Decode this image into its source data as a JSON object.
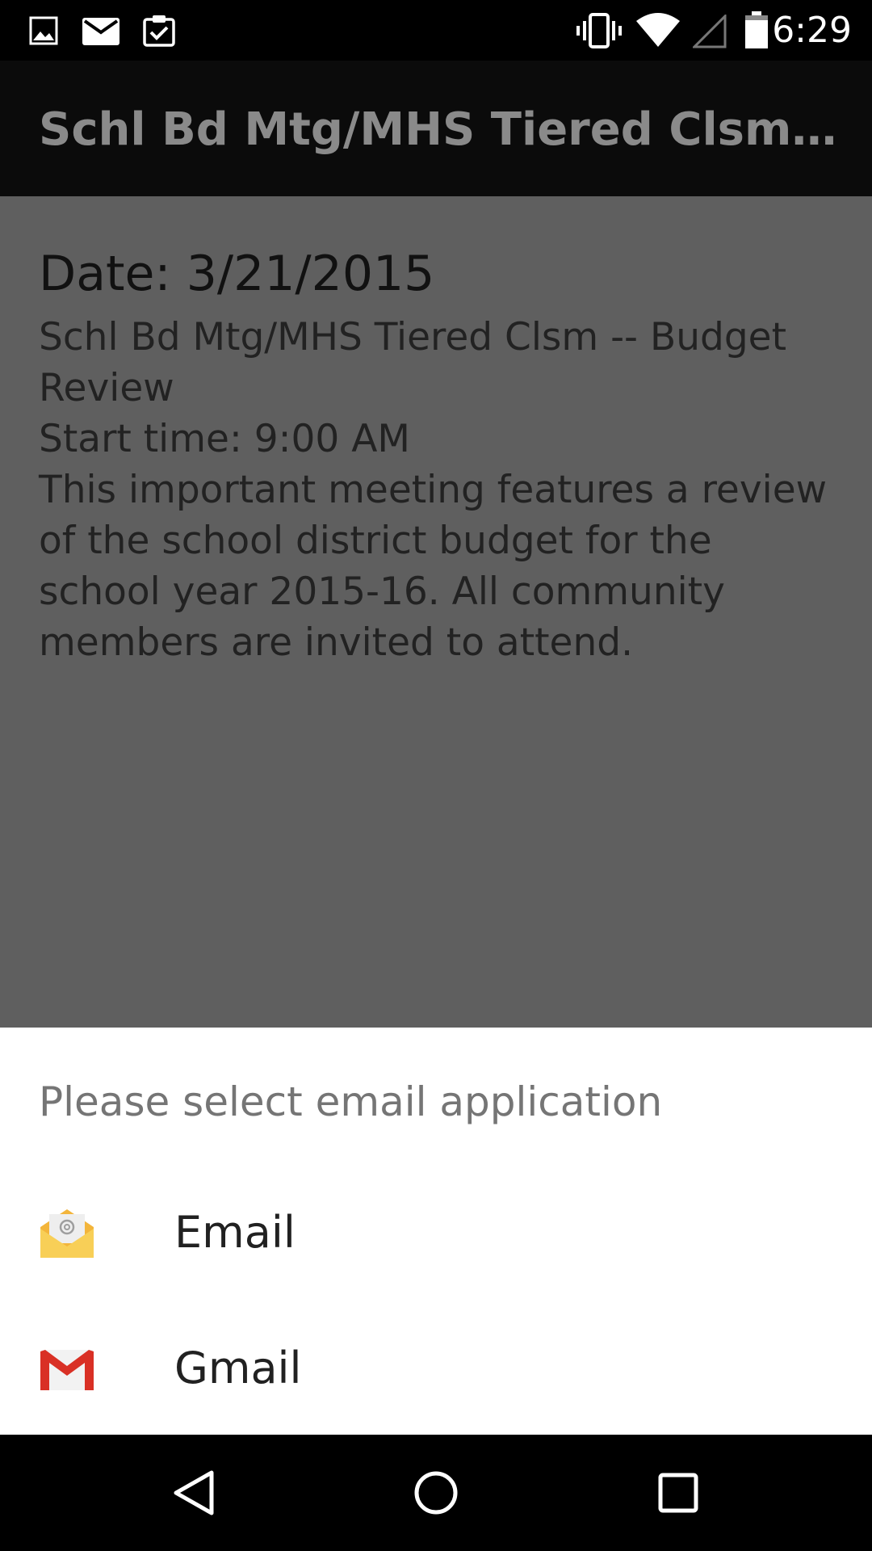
{
  "status_bar": {
    "time": "6:29",
    "left_icons": [
      "image-icon",
      "mail-icon",
      "clipboard-check-icon"
    ],
    "right_icons": [
      "vibrate-icon",
      "wifi-icon",
      "cell-signal-icon",
      "battery-icon"
    ]
  },
  "app_bar": {
    "title": "Schl Bd Mtg/MHS Tiered Clsm -- Budget Review"
  },
  "event": {
    "date_line": "Date: 3/21/2015",
    "title_line": "Schl Bd Mtg/MHS Tiered Clsm -- Budget Review",
    "start_time_line": "Start time: 9:00 AM",
    "description": "This important meeting features a review of the school district budget for the school year 2015-16. All community members are invited to attend."
  },
  "chooser": {
    "title": "Please select email application",
    "options": [
      {
        "label": "Email",
        "icon": "email-app-icon"
      },
      {
        "label": "Gmail",
        "icon": "gmail-icon"
      }
    ]
  },
  "nav_bar": {
    "buttons": [
      "back-icon",
      "home-icon",
      "recents-icon"
    ]
  },
  "colors": {
    "dim_background": "#5f5f5f",
    "sheet_background": "#ffffff",
    "gmail_red": "#d93025",
    "email_yellow": "#f6c343"
  }
}
